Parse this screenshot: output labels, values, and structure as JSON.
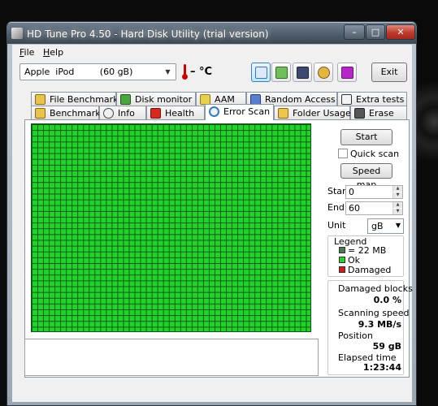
{
  "window": {
    "title": "HD Tune Pro 4.50 - Hard Disk Utility (trial version)",
    "controls": {
      "minimize": "–",
      "maximize": "□",
      "close": "✕"
    }
  },
  "menu": {
    "file": "File",
    "help": "Help"
  },
  "toolbar": {
    "drive": "Apple  iPod         (60 gB)",
    "temperature": "– °C",
    "exit_label": "Exit"
  },
  "tabs": {
    "row1": [
      "File Benchmark",
      "Disk monitor",
      "AAM",
      "Random Access",
      "Extra tests"
    ],
    "row2": [
      "Benchmark",
      "Info",
      "Health",
      "Error Scan",
      "Folder Usage",
      "Erase"
    ],
    "selected": "Error Scan"
  },
  "error_scan": {
    "start_button": "Start",
    "quick_scan_label": "Quick scan",
    "quick_scan_checked": false,
    "speed_map_button": "Speed map",
    "start_label": "Start",
    "start_value": "0",
    "end_label": "End",
    "end_value": "60",
    "unit_label": "Unit",
    "unit_value": "gB",
    "legend": {
      "title": "Legend",
      "block": "= 22 MB",
      "ok": "Ok",
      "damaged": "Damaged"
    },
    "stats": {
      "damaged_blocks_label": "Damaged blocks",
      "damaged_blocks_value": "0.0 %",
      "scanning_speed_label": "Scanning speed",
      "scanning_speed_value": "9.3 MB/s",
      "position_label": "Position",
      "position_value": "59 gB",
      "elapsed_label": "Elapsed time",
      "elapsed_value": "1:23:44"
    },
    "map_status": "all blocks ok"
  },
  "colors": {
    "ok_green": "#22d22a",
    "damaged_red": "#d21a1a",
    "grid_line": "#0a5a10"
  }
}
